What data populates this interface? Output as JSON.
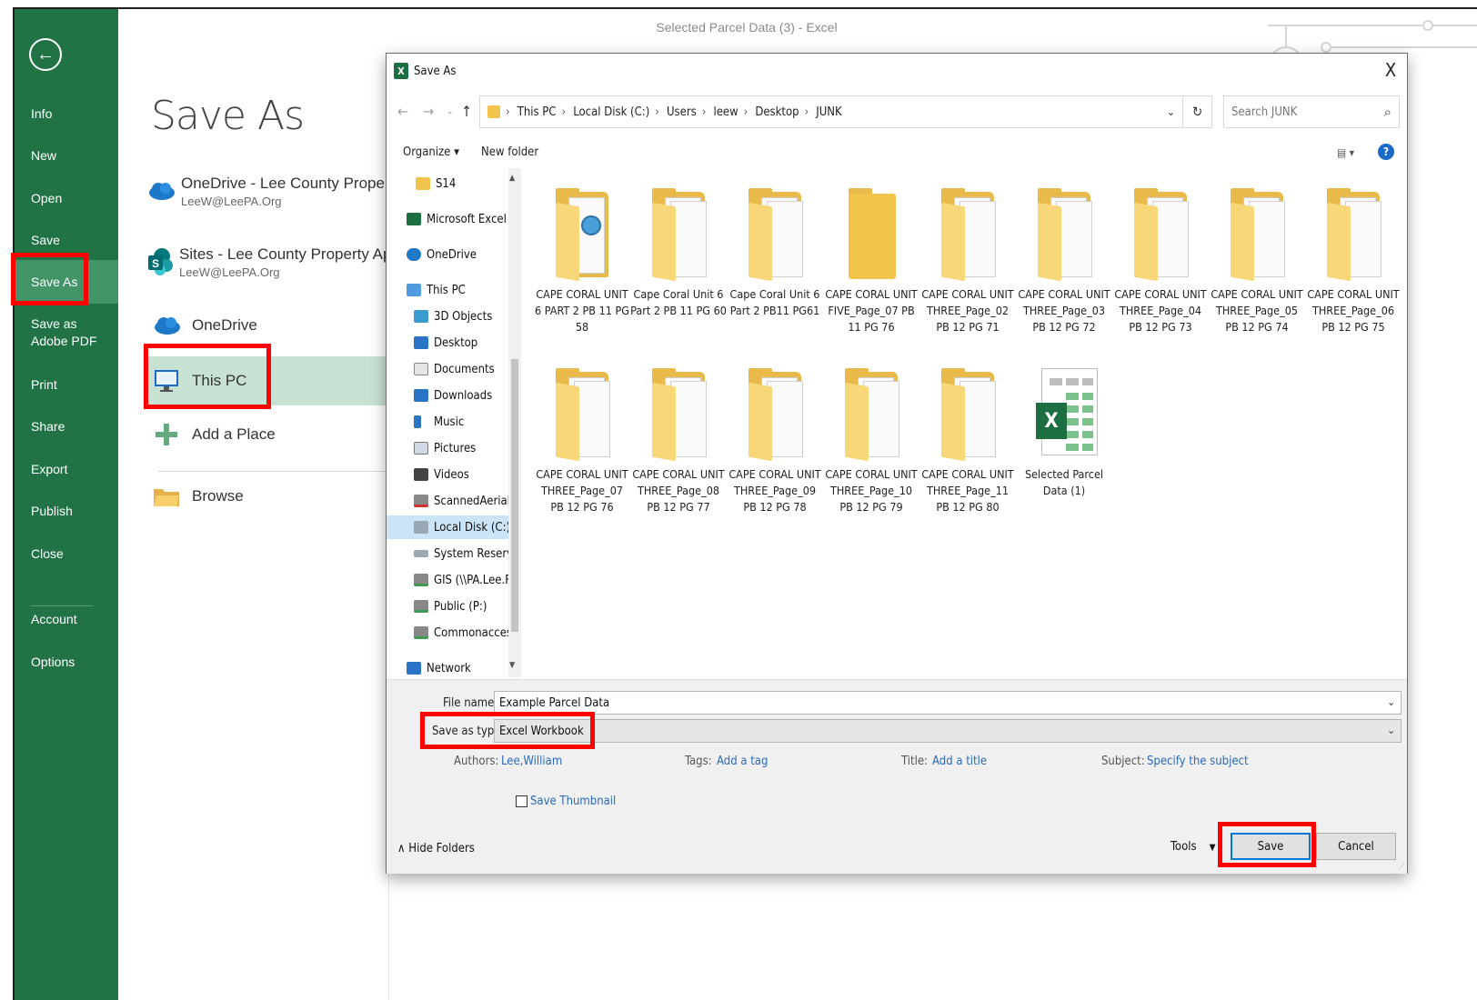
{
  "window": {
    "title": "Selected Parcel Data (3) - Excel"
  },
  "backstage": {
    "back_label": "←",
    "nav": [
      {
        "label": "Info"
      },
      {
        "label": "New"
      },
      {
        "label": "Open"
      },
      {
        "label": "Save"
      },
      {
        "label": "Save As",
        "selected": true
      },
      {
        "label": "Save as Adobe PDF"
      },
      {
        "label": "Print"
      },
      {
        "label": "Share"
      },
      {
        "label": "Export"
      },
      {
        "label": "Publish"
      },
      {
        "label": "Close"
      },
      {
        "label": "Account"
      },
      {
        "label": "Options"
      }
    ],
    "accent_color": "#217346"
  },
  "save_as_pane": {
    "title": "Save As",
    "places": [
      {
        "name": "OneDrive - Lee County Property...",
        "sub": "LeeW@LeePA.Org",
        "icon": "cloud-icon"
      },
      {
        "name": "Sites - Lee County Property App...",
        "sub": "LeeW@LeePA.Org",
        "icon": "sharepoint-icon"
      },
      {
        "name": "OneDrive",
        "sub": "",
        "icon": "cloud-icon"
      },
      {
        "name": "This PC",
        "sub": "",
        "icon": "computer-icon",
        "selected": true
      },
      {
        "name": "Add a Place",
        "sub": "",
        "icon": "plus-icon"
      },
      {
        "name": "Browse",
        "sub": "",
        "icon": "folder-icon"
      }
    ]
  },
  "dialog": {
    "title": "Save As",
    "close": "X",
    "address": {
      "crumbs": [
        "This PC",
        "Local Disk (C:)",
        "Users",
        "leew",
        "Desktop",
        "JUNK"
      ],
      "search_placeholder": "Search JUNK"
    },
    "toolbar": {
      "organize": "Organize ▾",
      "new_folder": "New folder",
      "help": "?"
    },
    "nav_pane": [
      {
        "label": "S14",
        "icon": "folder-icon"
      },
      {
        "label": "Microsoft Excel",
        "icon": "excel-icon"
      },
      {
        "label": "OneDrive",
        "icon": "cloud-icon"
      },
      {
        "label": "This PC",
        "icon": "computer-icon"
      },
      {
        "label": "3D Objects",
        "icon": "cube-icon"
      },
      {
        "label": "Desktop",
        "icon": "desktop-icon"
      },
      {
        "label": "Documents",
        "icon": "document-icon"
      },
      {
        "label": "Downloads",
        "icon": "download-icon"
      },
      {
        "label": "Music",
        "icon": "music-icon"
      },
      {
        "label": "Pictures",
        "icon": "picture-icon"
      },
      {
        "label": "Videos",
        "icon": "video-icon"
      },
      {
        "label": "ScannedAerialPD",
        "icon": "network-drive-icon"
      },
      {
        "label": "Local Disk (C:)",
        "icon": "disk-icon",
        "selected": true
      },
      {
        "label": "System Reserved",
        "icon": "disk-icon"
      },
      {
        "label": "GIS (\\\\PA.Lee.FL.",
        "icon": "network-drive-icon"
      },
      {
        "label": "Public (P:)",
        "icon": "network-drive-icon"
      },
      {
        "label": "Commonaccess",
        "icon": "network-drive-icon"
      },
      {
        "label": "Network",
        "icon": "network-icon"
      }
    ],
    "files": [
      {
        "name": "CAPE CORAL UNIT 6 PART 2 PB 11 PG 58",
        "kind": "folder-doc"
      },
      {
        "name": "Cape Coral Unit 6 Part 2 PB 11 PG 60",
        "kind": "folder"
      },
      {
        "name": "Cape Coral Unit 6 Part 2 PB11 PG61",
        "kind": "folder"
      },
      {
        "name": "CAPE CORAL UNIT FIVE_Page_07 PB 11 PG 76",
        "kind": "folder-empty"
      },
      {
        "name": "CAPE CORAL UNIT THREE_Page_02 PB 12 PG 71",
        "kind": "folder"
      },
      {
        "name": "CAPE CORAL UNIT THREE_Page_03 PB 12 PG 72",
        "kind": "folder"
      },
      {
        "name": "CAPE CORAL UNIT THREE_Page_04 PB 12 PG 73",
        "kind": "folder"
      },
      {
        "name": "CAPE CORAL UNIT THREE_Page_05 PB 12 PG 74",
        "kind": "folder"
      },
      {
        "name": "CAPE CORAL UNIT THREE_Page_06 PB 12 PG 75",
        "kind": "folder"
      },
      {
        "name": "CAPE CORAL UNIT THREE_Page_07 PB 12 PG 76",
        "kind": "folder"
      },
      {
        "name": "CAPE CORAL UNIT THREE_Page_08 PB 12 PG 77",
        "kind": "folder"
      },
      {
        "name": "CAPE CORAL UNIT THREE_Page_09 PB 12 PG 78",
        "kind": "folder"
      },
      {
        "name": "CAPE CORAL UNIT THREE_Page_10 PB 12 PG 79",
        "kind": "folder"
      },
      {
        "name": "CAPE CORAL UNIT THREE_Page_11 PB 12 PG 80",
        "kind": "folder"
      },
      {
        "name": "Selected Parcel Data (1)",
        "kind": "excel"
      }
    ],
    "form": {
      "file_name_label": "File name:",
      "file_name_value": "Example Parcel Data",
      "save_type_label": "Save as type:",
      "save_type_value": "Excel Workbook",
      "authors_label": "Authors:",
      "authors_value": "Lee,William",
      "tags_label": "Tags:",
      "tags_value": "Add a tag",
      "title_label": "Title:",
      "title_value": "Add a title",
      "subject_label": "Subject:",
      "subject_value": "Specify the subject",
      "save_thumbnail_label": "Save Thumbnail"
    },
    "footer": {
      "hide_folders": "Hide Folders",
      "tools": "Tools",
      "save": "Save",
      "cancel": "Cancel"
    }
  }
}
